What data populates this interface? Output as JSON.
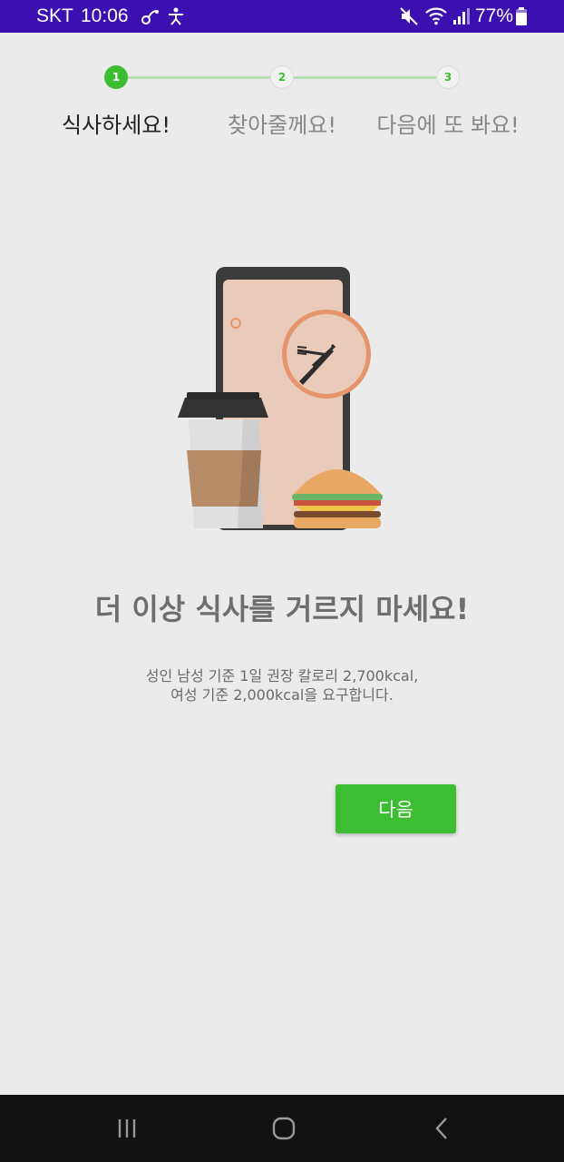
{
  "status_bar": {
    "carrier": "SKT",
    "time": "10:06",
    "battery": "77%",
    "icons": [
      "link-icon",
      "accessibility-icon",
      "mute-icon",
      "wifi-icon",
      "signal-icon",
      "battery-icon"
    ]
  },
  "stepper": {
    "steps": [
      {
        "number": "1",
        "label": "식사하세요!",
        "active": true
      },
      {
        "number": "2",
        "label": "찾아줄께요!",
        "active": false
      },
      {
        "number": "3",
        "label": "다음에 또 봐요!",
        "active": false
      }
    ],
    "active_color": "#3dbd32",
    "line_color": "#b8dfb4"
  },
  "illustration": {
    "icons": [
      "phone-icon",
      "clock-icon",
      "fork-knife-icon",
      "coffee-cup-icon",
      "burger-icon"
    ]
  },
  "content": {
    "headline": "더 이상 식사를 거르지 마세요!",
    "description_line1": "성인 남성 기준 1일 권장 칼로리 2,700kcal,",
    "description_line2": "여성 기준 2,000kcal을 요구합니다."
  },
  "next_button": {
    "label": "다음",
    "color": "#3dbd32"
  },
  "nav_bar": {
    "icons": [
      "recent-apps-icon",
      "home-icon",
      "back-icon"
    ]
  }
}
